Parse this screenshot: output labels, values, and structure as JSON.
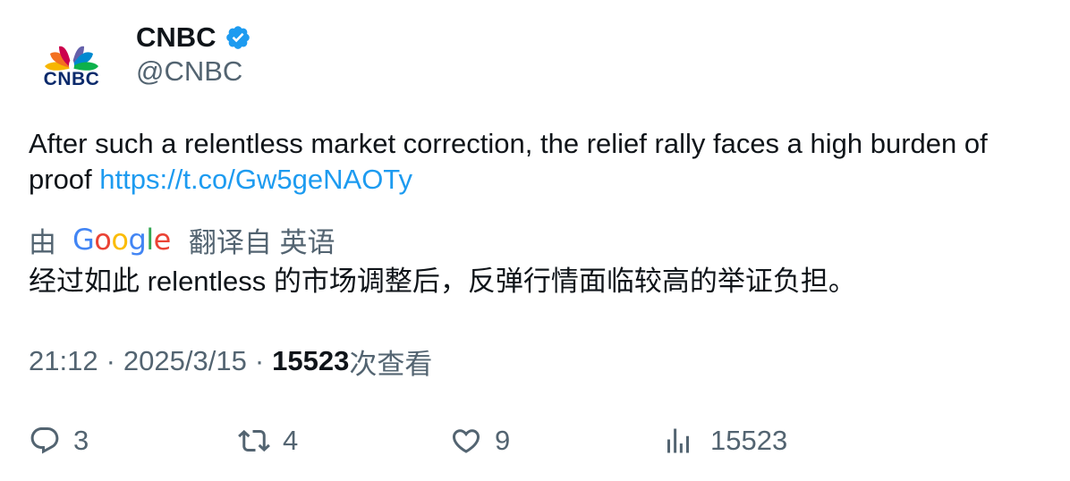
{
  "author": {
    "display_name": "CNBC",
    "handle": "@CNBC",
    "logo_text": "CNBC",
    "verified_icon": "verified-badge-icon",
    "verified_color": "#1d9bf0"
  },
  "tweet": {
    "text": "After such a relentless market correction, the relief rally faces a high burden of proof ",
    "link": "https://t.co/Gw5geNAOTy",
    "link_color": "#1d9bf0"
  },
  "translation": {
    "prefix": "由",
    "provider_name": "Google",
    "suffix": "翻译自 英语",
    "text": "经过如此 relentless 的市场调整后，反弹行情面临较高的举证负担。"
  },
  "meta": {
    "time": "21:12",
    "separator": "·",
    "date": "2025/3/15",
    "views_count": "15523",
    "views_label": "次查看"
  },
  "actions": {
    "reply": {
      "icon": "reply-icon",
      "count": "3"
    },
    "retweet": {
      "icon": "retweet-icon",
      "count": "4"
    },
    "like": {
      "icon": "heart-icon",
      "count": "9"
    },
    "views": {
      "icon": "analytics-icon",
      "count": "15523"
    }
  },
  "colors": {
    "text_primary": "#0f1419",
    "text_secondary": "#536471",
    "link": "#1d9bf0",
    "brand_navy": "#0b2a6b"
  }
}
